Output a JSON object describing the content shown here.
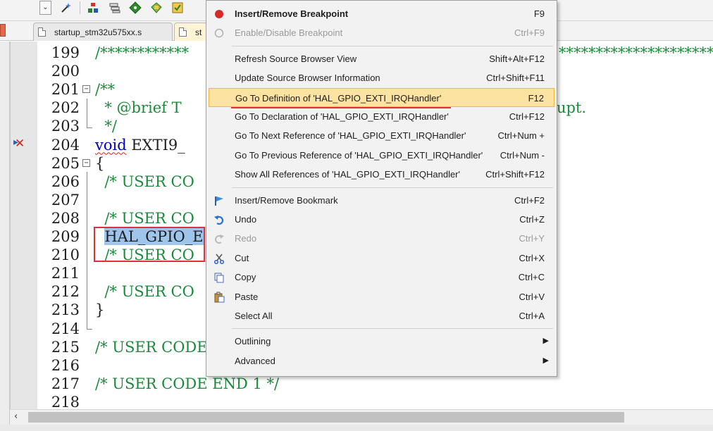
{
  "tabs": [
    {
      "label": "startup_stm32u575xx.s"
    },
    {
      "label": "st"
    }
  ],
  "editor": {
    "lines": [
      {
        "num": "199",
        "segments": [
          {
            "text": "/************",
            "cls": "c-comment"
          }
        ],
        "right": "*****************************"
      },
      {
        "num": "200",
        "segments": []
      },
      {
        "num": "201",
        "fold": "−",
        "segments": [
          {
            "text": "/**",
            "cls": "c-comment"
          }
        ]
      },
      {
        "num": "202",
        "segments": [
          {
            "text": "  * @brief T",
            "cls": "c-comment"
          }
        ],
        "right": "upt."
      },
      {
        "num": "203",
        "segments": [
          {
            "text": "  */",
            "cls": "c-comment"
          }
        ]
      },
      {
        "num": "204",
        "segments": [
          {
            "text": "void",
            "cls": "c-kw squig"
          },
          {
            "text": " EXTI9_",
            "cls": "c-plain"
          }
        ]
      },
      {
        "num": "205",
        "fold": "−",
        "segments": [
          {
            "text": "{",
            "cls": "c-plain"
          }
        ]
      },
      {
        "num": "206",
        "segments": [
          {
            "text": "  /* USER CO",
            "cls": "c-comment"
          }
        ]
      },
      {
        "num": "207",
        "segments": []
      },
      {
        "num": "208",
        "segments": [
          {
            "text": "  /* USER CO",
            "cls": "c-comment"
          }
        ]
      },
      {
        "num": "209",
        "segments": [
          {
            "text": "  ",
            "cls": "c-plain"
          },
          {
            "text": "HAL_GPIO_E",
            "cls": "sel"
          }
        ]
      },
      {
        "num": "210",
        "segments": [
          {
            "text": "  /* USER CO",
            "cls": "c-comment"
          }
        ]
      },
      {
        "num": "211",
        "segments": []
      },
      {
        "num": "212",
        "segments": [
          {
            "text": "  /* USER CO",
            "cls": "c-comment"
          }
        ]
      },
      {
        "num": "213",
        "segments": [
          {
            "text": "}",
            "cls": "c-plain"
          }
        ]
      },
      {
        "num": "214",
        "segments": []
      },
      {
        "num": "215",
        "segments": [
          {
            "text": "/* USER CODE",
            "cls": "c-comment"
          }
        ]
      },
      {
        "num": "216",
        "segments": []
      },
      {
        "num": "217",
        "segments": [
          {
            "text": "/* USER CODE END 1 */",
            "cls": "c-comment"
          }
        ]
      },
      {
        "num": "218",
        "segments": []
      }
    ]
  },
  "context_menu": {
    "items": [
      {
        "label": "Insert/Remove Breakpoint",
        "shortcut": "F9",
        "icon": "breakpoint-icon",
        "bold": true
      },
      {
        "label": "Enable/Disable Breakpoint",
        "shortcut": "Ctrl+F9",
        "icon": "breakpoint-disabled-icon",
        "disabled": true
      },
      {
        "separator": true
      },
      {
        "label": "Refresh Source Browser View",
        "shortcut": "Shift+Alt+F12"
      },
      {
        "label": "Update Source Browser Information",
        "shortcut": "Ctrl+Shift+F11"
      },
      {
        "label": "Go To Definition of 'HAL_GPIO_EXTI_IRQHandler'",
        "shortcut": "F12",
        "highlighted": true
      },
      {
        "label": "Go To Declaration of 'HAL_GPIO_EXTI_IRQHandler'",
        "shortcut": "Ctrl+F12"
      },
      {
        "label": "Go To Next Reference of 'HAL_GPIO_EXTI_IRQHandler'",
        "shortcut": "Ctrl+Num +"
      },
      {
        "label": "Go To Previous Reference of 'HAL_GPIO_EXTI_IRQHandler'",
        "shortcut": "Ctrl+Num -"
      },
      {
        "label": "Show All References of 'HAL_GPIO_EXTI_IRQHandler'",
        "shortcut": "Ctrl+Shift+F12"
      },
      {
        "separator": true
      },
      {
        "label": "Insert/Remove Bookmark",
        "shortcut": "Ctrl+F2",
        "icon": "bookmark-flag-icon"
      },
      {
        "label": "Undo",
        "shortcut": "Ctrl+Z",
        "icon": "undo-icon"
      },
      {
        "label": "Redo",
        "shortcut": "Ctrl+Y",
        "icon": "redo-icon",
        "disabled": true
      },
      {
        "label": "Cut",
        "shortcut": "Ctrl+X",
        "icon": "cut-icon"
      },
      {
        "label": "Copy",
        "shortcut": "Ctrl+C",
        "icon": "copy-icon"
      },
      {
        "label": "Paste",
        "shortcut": "Ctrl+V",
        "icon": "paste-icon"
      },
      {
        "label": "Select All",
        "shortcut": "Ctrl+A"
      },
      {
        "separator": true
      },
      {
        "label": "Outlining",
        "submenu": true
      },
      {
        "label": "Advanced",
        "submenu": true
      }
    ]
  },
  "colors": {
    "highlight_bg": "#fde3a2",
    "highlight_border": "#f0b840",
    "annotation_red": "#e0303a",
    "comment_green": "#1a8a3a",
    "keyword_blue": "#0000c0",
    "selection_blue": "#9ec6ec"
  }
}
